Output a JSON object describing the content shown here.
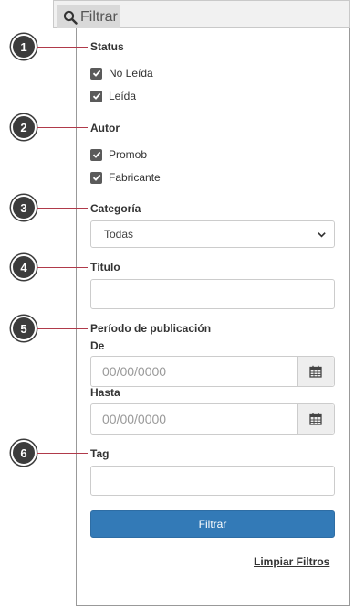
{
  "tab": {
    "label": "Filtrar",
    "icon": "search-icon"
  },
  "callouts": [
    "1",
    "2",
    "3",
    "4",
    "5",
    "6"
  ],
  "status": {
    "label": "Status",
    "options": [
      {
        "label": "No Leída",
        "checked": true
      },
      {
        "label": "Leída",
        "checked": true
      }
    ]
  },
  "autor": {
    "label": "Autor",
    "options": [
      {
        "label": "Promob",
        "checked": true
      },
      {
        "label": "Fabricante",
        "checked": true
      }
    ]
  },
  "categoria": {
    "label": "Categoría",
    "selected": "Todas"
  },
  "titulo": {
    "label": "Título",
    "value": ""
  },
  "periodo": {
    "label": "Período de publicación",
    "from_label": "De",
    "from_placeholder": "00/00/0000",
    "to_label": "Hasta",
    "to_placeholder": "00/00/0000"
  },
  "tag": {
    "label": "Tag",
    "value": ""
  },
  "actions": {
    "filter_label": "Filtrar",
    "clear_label": "Limpiar Filtros"
  },
  "colors": {
    "primary": "#337ab7",
    "callout": "#3c3c3c",
    "callout_line": "#b03a4a",
    "checkbox": "#5a5a5a"
  }
}
